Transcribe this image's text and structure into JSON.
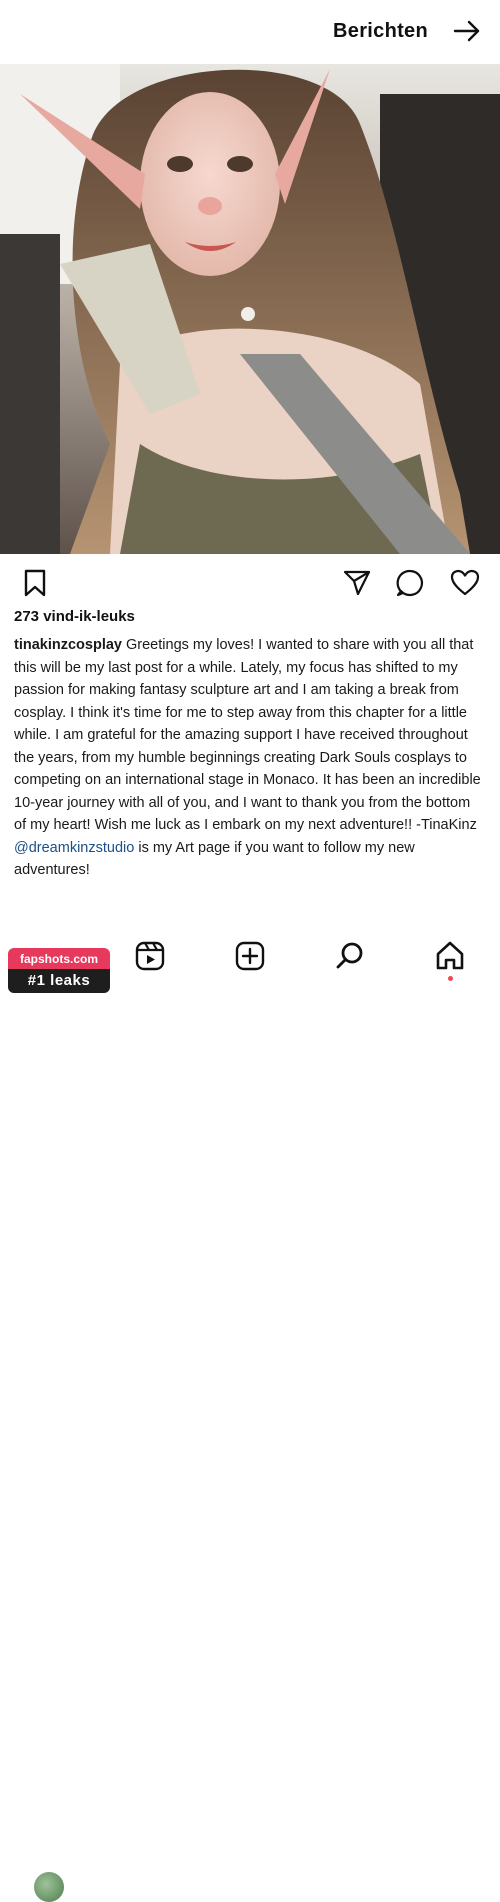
{
  "header": {
    "title": "Berichten",
    "back_icon": "arrow-right-icon"
  },
  "post": {
    "image_alt": "selfie",
    "likes": "273 vind-ik-leuks",
    "author": "tinakinzcosplay",
    "caption_p1": " Greetings my loves! I wanted to share with you all that this will be my last post for a while. Lately, my focus has shifted to my passion for making fantasy sculpture art and I am taking a break from cosplay. I think it's time for me to step away from this chapter for a little while. I am grateful for the amazing support I have received throughout the years, from my humble beginnings creating Dark Souls cosplays to competing on an international stage in Monaco. It has been an incredible 10-year journey with all of you, and I want to thank you from the bottom of my heart! Wish me luck as I embark on my next adventure!! -TinaKinz",
    "mention": "@dreamkinzstudio",
    "caption_p2": " is my Art page if you want to follow my new adventures!"
  },
  "actions": {
    "like_icon": "heart-icon",
    "comment_icon": "comment-icon",
    "share_icon": "send-icon",
    "save_icon": "bookmark-icon"
  },
  "bottom_nav": {
    "items": [
      "home-icon",
      "search-icon",
      "create-icon",
      "reels-icon",
      "profile-avatar"
    ]
  },
  "watermark": {
    "site": "fapshots.com",
    "tagline": "#1 leaks"
  },
  "colors": {
    "accent": "#ed4956",
    "mention": "#1c4f87",
    "watermark_pink": "#e6395c"
  }
}
